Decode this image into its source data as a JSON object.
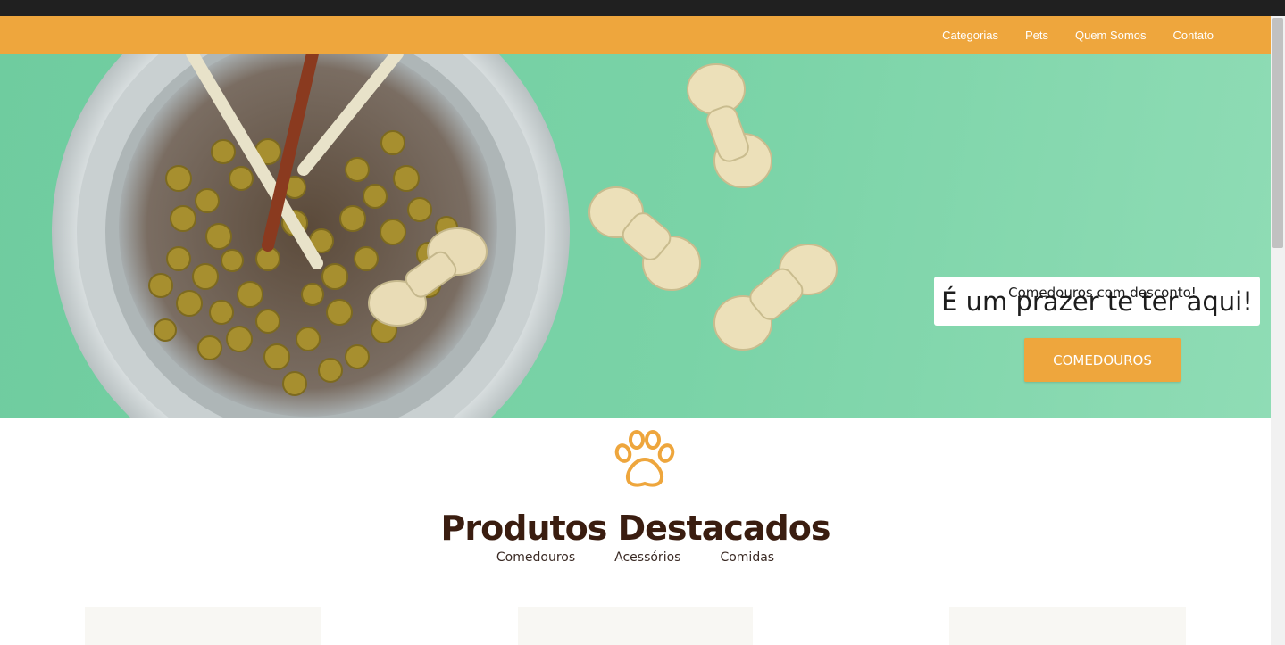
{
  "nav": {
    "links": [
      "Categorias",
      "Pets",
      "Quem Somos",
      "Contato"
    ]
  },
  "hero": {
    "welcome": "É um prazer te ter aqui!",
    "subtitle": "Comedouros com desconto!",
    "button": "COMEDOUROS"
  },
  "featured": {
    "icon": "paw-icon",
    "title": "Produtos Destacados",
    "filters": [
      "Comedouros",
      "Acessórios",
      "Comidas"
    ]
  },
  "colors": {
    "accent": "#eea63d",
    "hero_bg": "#7ad3a7",
    "title": "#3a1d10"
  }
}
